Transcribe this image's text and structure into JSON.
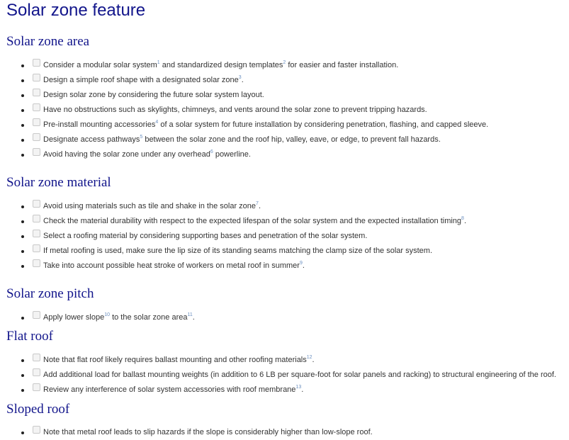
{
  "title": "Solar zone feature",
  "sections": [
    {
      "heading": "Solar zone area",
      "items": [
        [
          {
            "t": "Consider a modular solar system"
          },
          {
            "r": "1"
          },
          {
            "t": " and standardized design templates"
          },
          {
            "r": "2"
          },
          {
            "t": " for easier and faster installation."
          }
        ],
        [
          {
            "t": "Design a simple roof shape with a designated solar zone"
          },
          {
            "r": "3"
          },
          {
            "t": "."
          }
        ],
        [
          {
            "t": "Design solar zone by considering the future solar system layout."
          }
        ],
        [
          {
            "t": "Have no obstructions such as skylights, chimneys, and vents around the solar zone to prevent tripping hazards."
          }
        ],
        [
          {
            "t": "Pre-install mounting accessories"
          },
          {
            "r": "4"
          },
          {
            "t": " of a solar system for future installation by considering penetration, flashing, and capped sleeve."
          }
        ],
        [
          {
            "t": "Designate access pathways"
          },
          {
            "r": "5"
          },
          {
            "t": " between the solar zone and the roof hip, valley, eave, or edge, to prevent fall hazards."
          }
        ],
        [
          {
            "t": "Avoid having the solar zone under any overhead"
          },
          {
            "r": "6"
          },
          {
            "t": " powerline."
          }
        ]
      ]
    },
    {
      "heading": "Solar zone material",
      "items": [
        [
          {
            "t": "Avoid using materials such as tile and shake in the solar zone"
          },
          {
            "r": "7"
          },
          {
            "t": "."
          }
        ],
        [
          {
            "t": "Check the material durability with respect to the expected lifespan of the solar system and the expected installation timing"
          },
          {
            "r": "8"
          },
          {
            "t": "."
          }
        ],
        [
          {
            "t": "Select a roofing material by considering supporting bases and penetration of the solar system."
          }
        ],
        [
          {
            "t": "If metal roofing is used, make sure the lip size of its standing seams matching the clamp size of the solar system."
          }
        ],
        [
          {
            "t": "Take into account possible heat stroke of workers on metal roof in summer"
          },
          {
            "r": "9"
          },
          {
            "t": "."
          }
        ]
      ]
    },
    {
      "heading": "Solar zone pitch",
      "items": [
        [
          {
            "t": "Apply lower slope"
          },
          {
            "r": "10"
          },
          {
            "t": " to the solar zone area"
          },
          {
            "r": "11"
          },
          {
            "t": "."
          }
        ]
      ]
    },
    {
      "heading": "Flat roof",
      "items": [
        [
          {
            "t": "Note that flat roof likely requires ballast mounting and other roofing materials"
          },
          {
            "r": "12"
          },
          {
            "t": "."
          }
        ],
        [
          {
            "t": "Add additional load for ballast mounting weights (in addition to 6 LB per square-foot for solar panels and racking) to structural engineering of the roof."
          }
        ],
        [
          {
            "t": "Review any interference of solar system accessories with roof membrane"
          },
          {
            "r": "13"
          },
          {
            "t": "."
          }
        ]
      ]
    },
    {
      "heading": "Sloped roof",
      "items": [
        [
          {
            "t": "Note that metal roof leads to slip hazards if the slope is considerably higher than low-slope roof."
          }
        ]
      ]
    }
  ]
}
